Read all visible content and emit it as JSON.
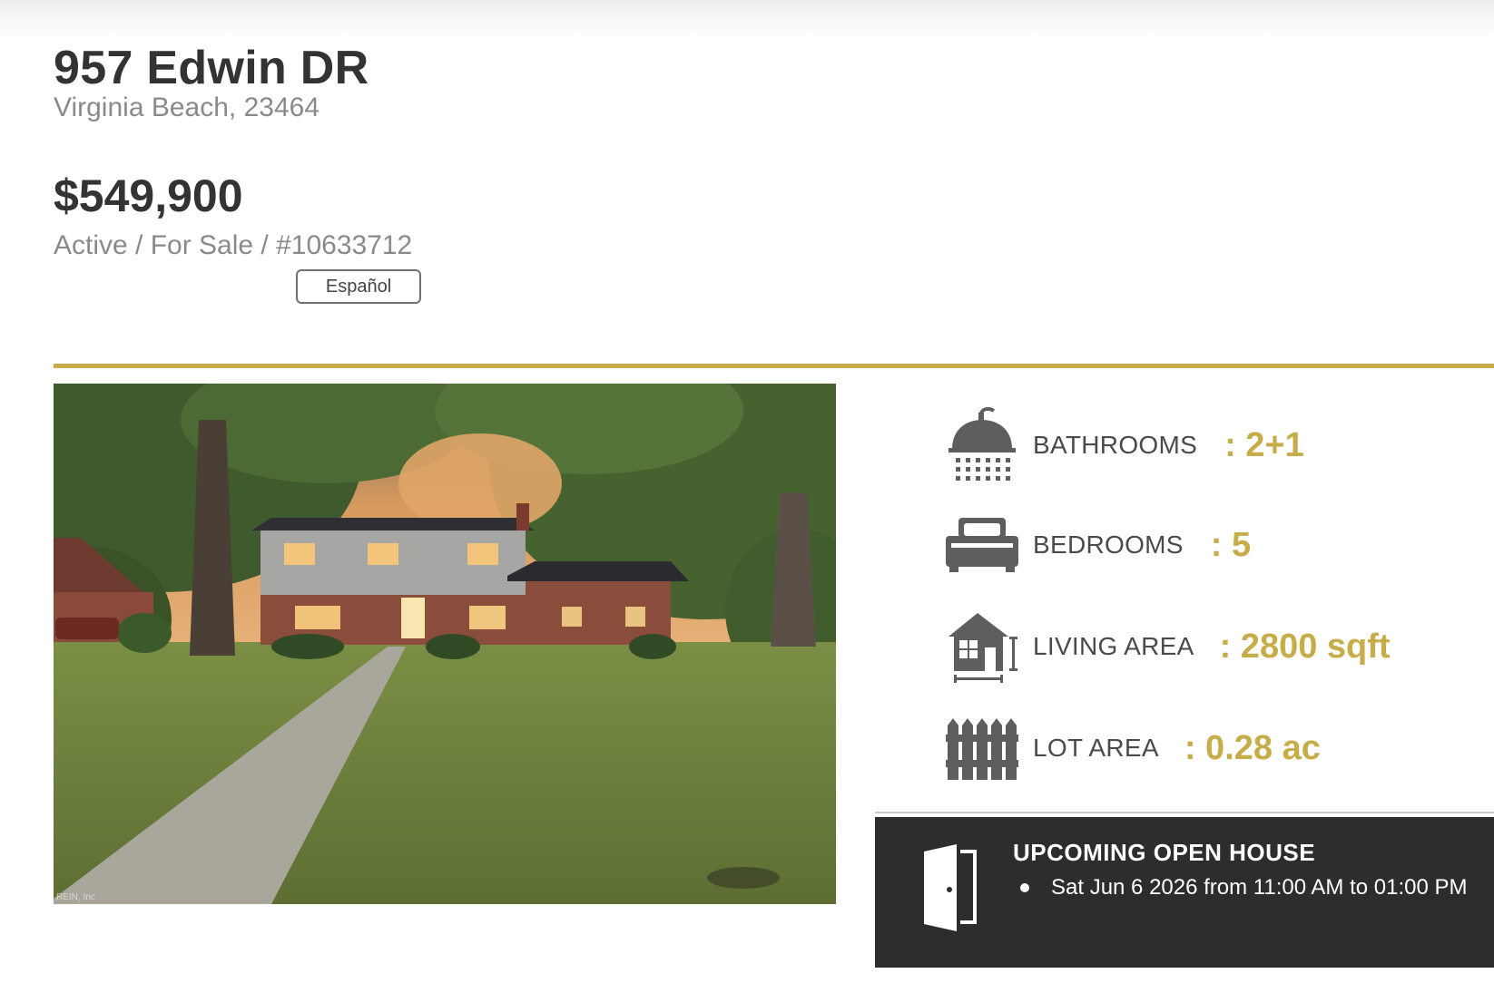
{
  "listing": {
    "street": "957 Edwin DR",
    "city_zip": "Virginia Beach, 23464",
    "price": "$549,900",
    "status_line": "Active / For Sale / #10633712",
    "language_button": "Español"
  },
  "photo": {
    "watermark": "REIN, Inc"
  },
  "facts": [
    {
      "icon": "shower-icon",
      "label": "BATHROOMS",
      "value": ": 2+1"
    },
    {
      "icon": "bed-icon",
      "label": "BEDROOMS",
      "value": ": 5"
    },
    {
      "icon": "house-area-icon",
      "label": "LIVING AREA",
      "value": ": 2800 sqft"
    },
    {
      "icon": "fence-icon",
      "label": "LOT AREA",
      "value": ": 0.28 ac"
    }
  ],
  "open_house": {
    "title": "UPCOMING OPEN HOUSE",
    "items": [
      "Sat Jun 6 2026 from 11:00 AM to 01:00 PM"
    ]
  },
  "colors": {
    "accent_gold": "#c6ad4a",
    "dark_panel": "#2d2d2d",
    "icon_gray": "#5e5e5e"
  }
}
